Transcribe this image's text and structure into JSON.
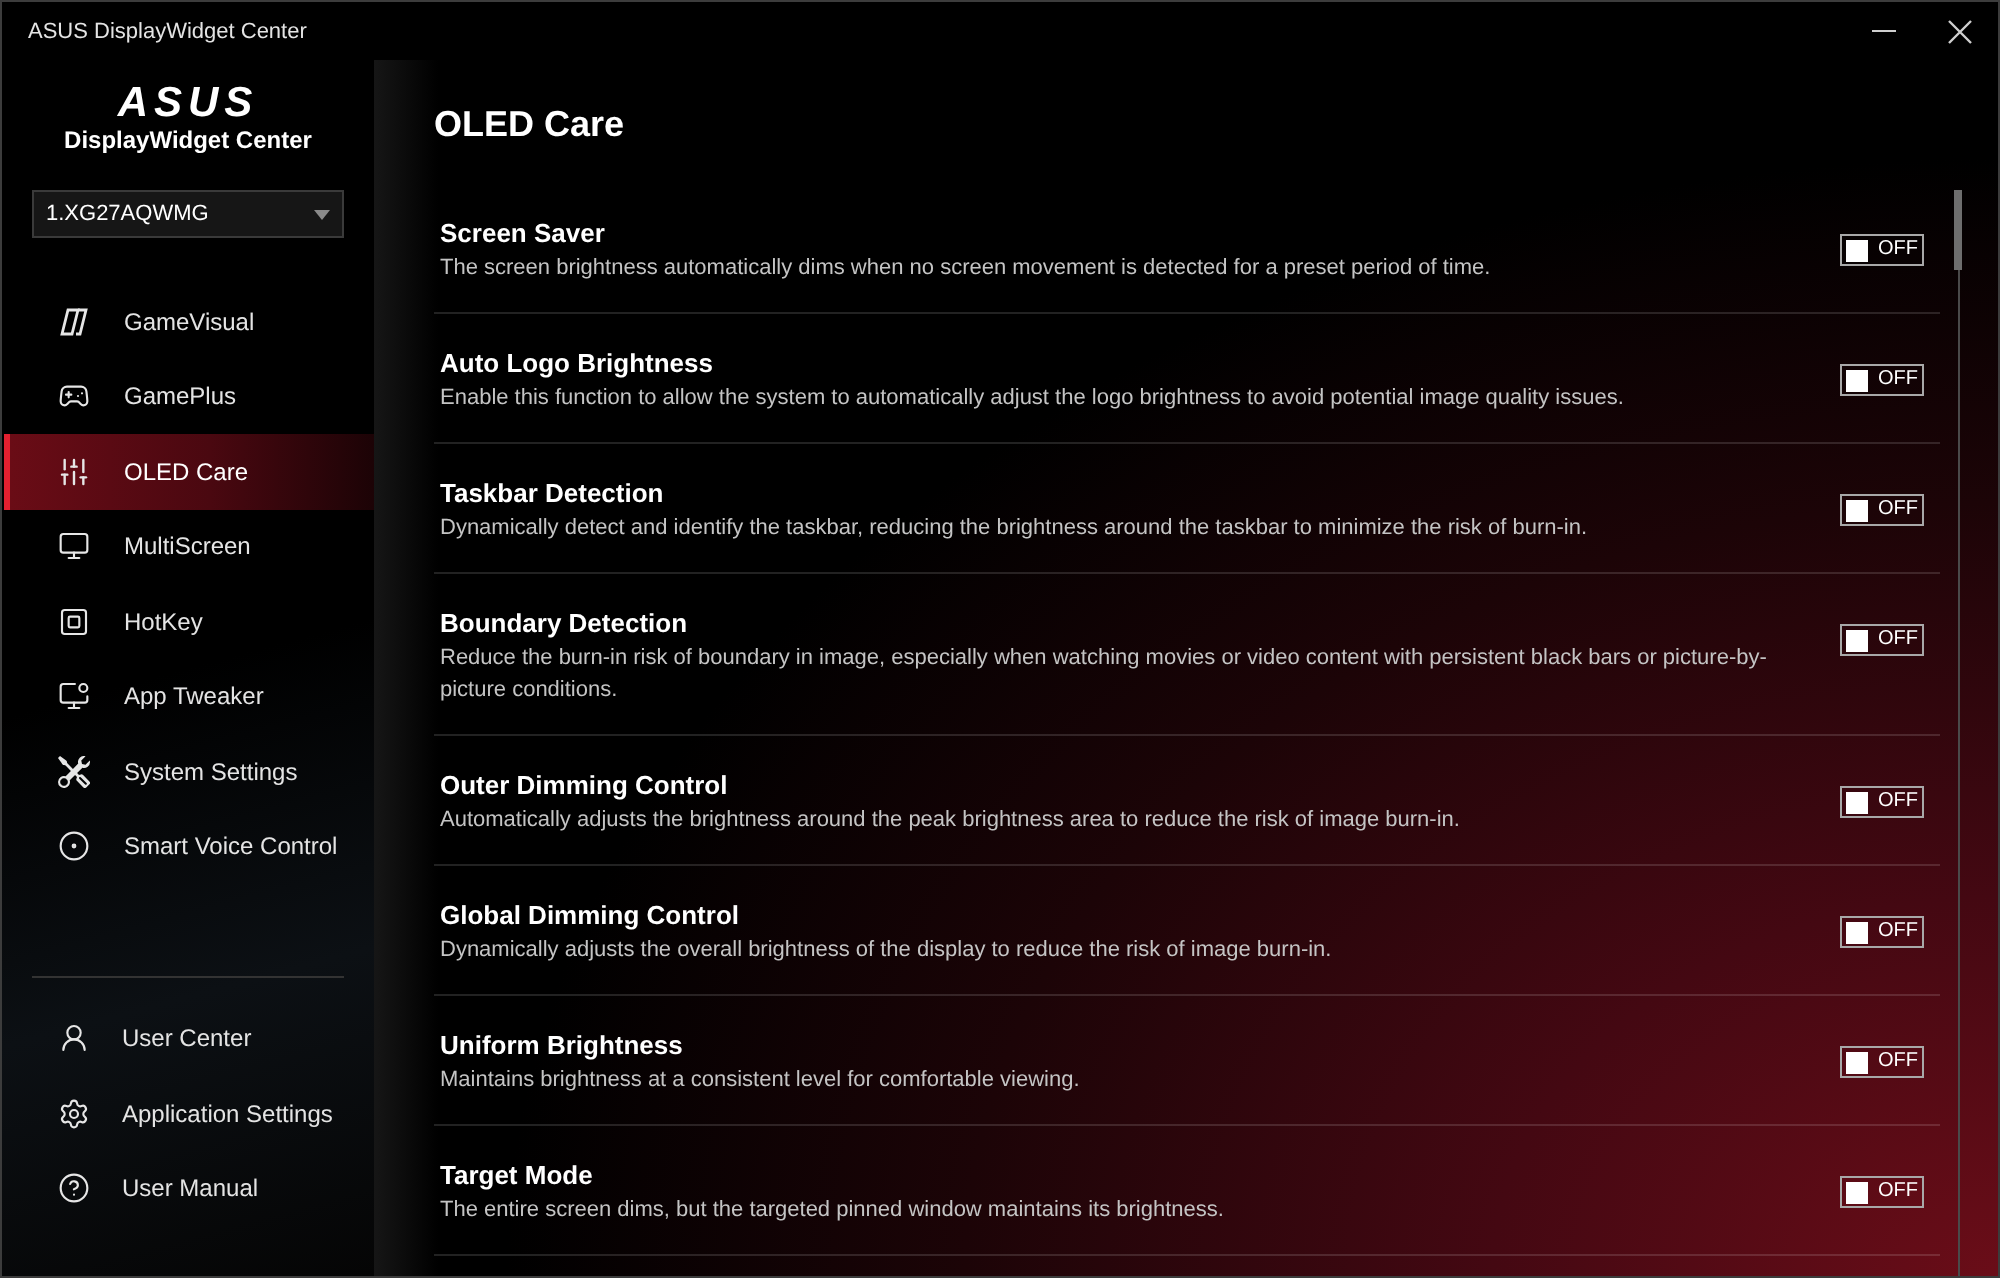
{
  "window": {
    "title": "ASUS DisplayWidget Center"
  },
  "sidebar": {
    "logo": "ASUS",
    "app_name": "DisplayWidget Center",
    "monitor_select": {
      "value": "1.XG27AQWMG"
    },
    "items": [
      {
        "label": "GameVisual",
        "selected": false
      },
      {
        "label": "GamePlus",
        "selected": false
      },
      {
        "label": "OLED Care",
        "selected": true
      },
      {
        "label": "MultiScreen",
        "selected": false
      },
      {
        "label": "HotKey",
        "selected": false
      },
      {
        "label": "App Tweaker",
        "selected": false
      },
      {
        "label": "System Settings",
        "selected": false
      },
      {
        "label": "Smart Voice Control",
        "selected": false
      }
    ],
    "footer_items": [
      {
        "label": "User Center",
        "selected": false
      },
      {
        "label": "Application Settings",
        "selected": false
      },
      {
        "label": "User Manual",
        "selected": false
      }
    ]
  },
  "page": {
    "title": "OLED Care"
  },
  "settings": [
    {
      "title": "Screen Saver",
      "description": "The screen brightness automatically dims when no screen movement is detected for a preset period of time.",
      "on": false,
      "state_label": "OFF"
    },
    {
      "title": "Auto Logo Brightness",
      "description": "Enable this function to allow the system to automatically adjust the logo brightness to avoid potential image quality issues.",
      "on": false,
      "state_label": "OFF"
    },
    {
      "title": "Taskbar Detection",
      "description": "Dynamically detect and identify the taskbar, reducing the brightness around the taskbar to minimize the risk of burn-in.",
      "on": false,
      "state_label": "OFF"
    },
    {
      "title": "Boundary Detection",
      "description": "Reduce the burn-in risk of boundary in image, especially when watching movies or video content with persistent black bars or picture-by-picture conditions.",
      "on": false,
      "state_label": "OFF"
    },
    {
      "title": "Outer Dimming Control",
      "description": "Automatically adjusts the brightness around the peak brightness area to reduce the risk of image burn-in.",
      "on": false,
      "state_label": "OFF"
    },
    {
      "title": "Global Dimming Control",
      "description": "Dynamically adjusts the overall brightness of the display to reduce the risk of image burn-in.",
      "on": false,
      "state_label": "OFF"
    },
    {
      "title": "Uniform Brightness",
      "description": "Maintains brightness at a consistent level for comfortable viewing.",
      "on": false,
      "state_label": "OFF"
    },
    {
      "title": "Target Mode",
      "description": "The entire screen dims, but the targeted pinned window maintains its brightness.",
      "on": false,
      "state_label": "OFF"
    }
  ]
}
